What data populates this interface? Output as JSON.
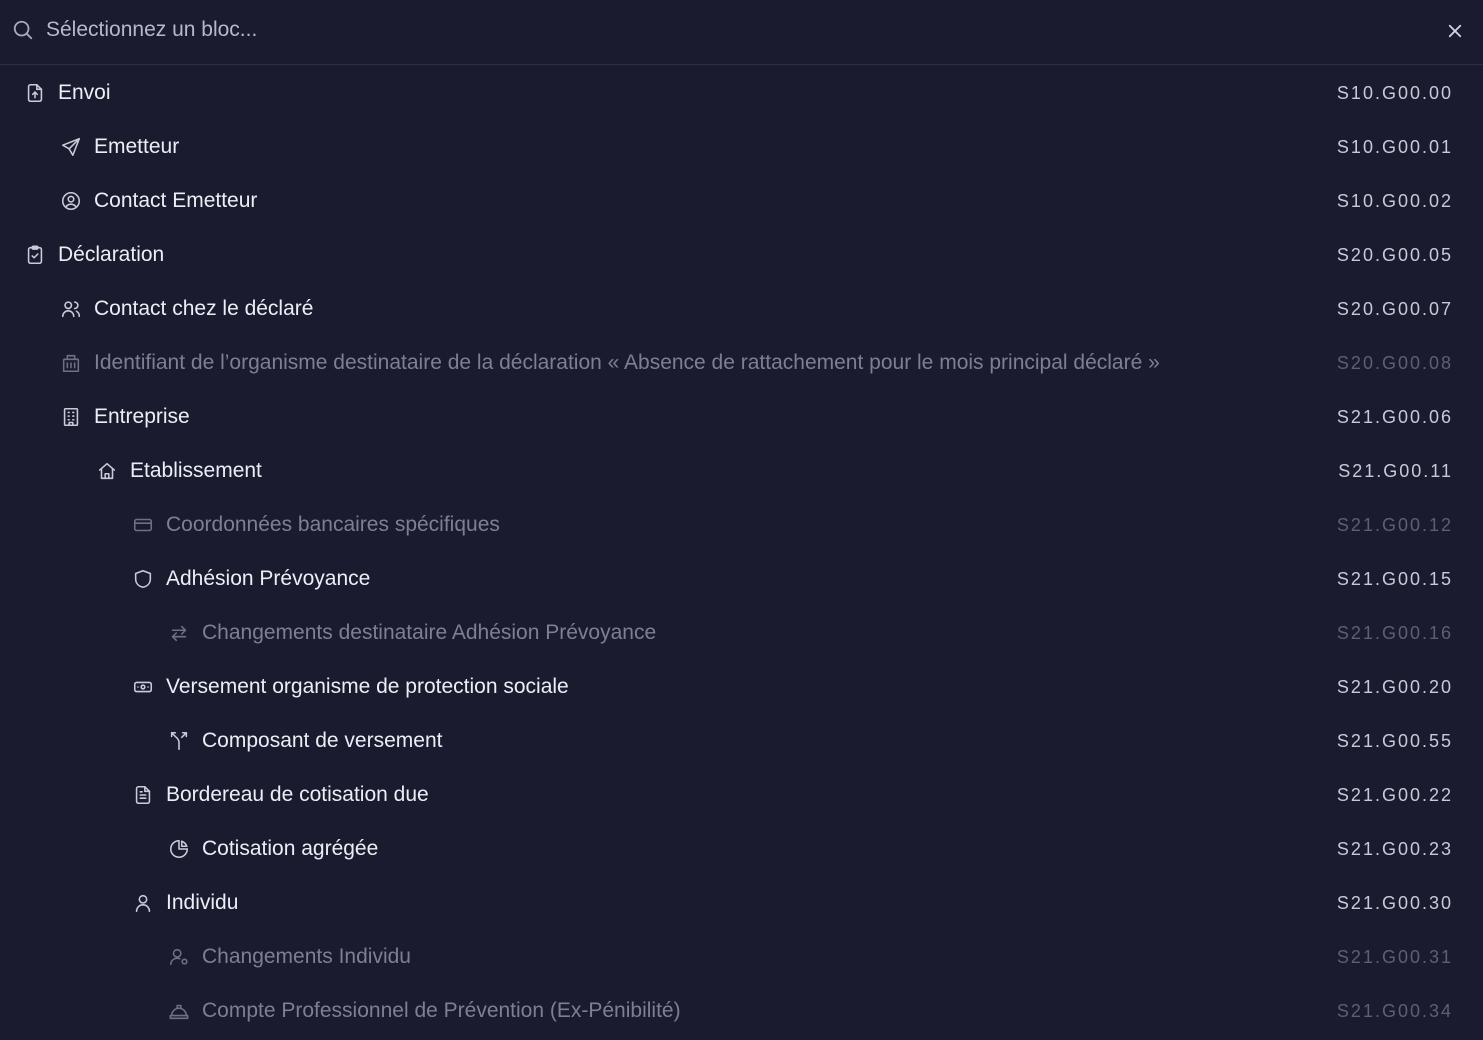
{
  "search": {
    "placeholder": "Sélectionnez un bloc..."
  },
  "colors": {
    "background": "#1b1b2f",
    "text": "#eceef6",
    "text_dim": "#7d7f92",
    "code": "#c8cad8",
    "code_dim": "#5d5f72"
  },
  "items": [
    {
      "label": "Envoi",
      "code": "S10.G00.00",
      "icon": "file-upload-icon",
      "level": 0,
      "dim": false
    },
    {
      "label": "Emetteur",
      "code": "S10.G00.01",
      "icon": "send-icon",
      "level": 1,
      "dim": false
    },
    {
      "label": "Contact Emetteur",
      "code": "S10.G00.02",
      "icon": "user-circle-icon",
      "level": 1,
      "dim": false
    },
    {
      "label": "Déclaration",
      "code": "S20.G00.05",
      "icon": "clipboard-check-icon",
      "level": 0,
      "dim": false
    },
    {
      "label": "Contact chez le déclaré",
      "code": "S20.G00.07",
      "icon": "users-icon",
      "level": 1,
      "dim": false
    },
    {
      "label": "Identifiant de l’organisme destinataire de la déclaration « Absence de rattachement pour le mois principal déclaré »",
      "code": "S20.G00.08",
      "icon": "building-bank-icon",
      "level": 1,
      "dim": true
    },
    {
      "label": "Entreprise",
      "code": "S21.G00.06",
      "icon": "building-icon",
      "level": 1,
      "dim": false
    },
    {
      "label": "Etablissement",
      "code": "S21.G00.11",
      "icon": "home-icon",
      "level": 2,
      "dim": false
    },
    {
      "label": "Coordonnées bancaires spécifiques",
      "code": "S21.G00.12",
      "icon": "credit-card-icon",
      "level": 3,
      "dim": true
    },
    {
      "label": "Adhésion Prévoyance",
      "code": "S21.G00.15",
      "icon": "shield-icon",
      "level": 3,
      "dim": false
    },
    {
      "label": "Changements destinataire Adhésion Prévoyance",
      "code": "S21.G00.16",
      "icon": "arrows-exchange-icon",
      "level": 4,
      "dim": true
    },
    {
      "label": "Versement organisme de protection sociale",
      "code": "S21.G00.20",
      "icon": "cash-icon",
      "level": 3,
      "dim": false
    },
    {
      "label": "Composant de versement",
      "code": "S21.G00.55",
      "icon": "split-icon",
      "level": 4,
      "dim": false
    },
    {
      "label": "Bordereau de cotisation due",
      "code": "S21.G00.22",
      "icon": "file-text-icon",
      "level": 3,
      "dim": false
    },
    {
      "label": "Cotisation agrégée",
      "code": "S21.G00.23",
      "icon": "pie-chart-icon",
      "level": 4,
      "dim": false
    },
    {
      "label": "Individu",
      "code": "S21.G00.30",
      "icon": "user-icon",
      "level": 3,
      "dim": false
    },
    {
      "label": "Changements Individu",
      "code": "S21.G00.31",
      "icon": "user-cog-icon",
      "level": 4,
      "dim": true
    },
    {
      "label": "Compte Professionnel de Prévention (Ex-Pénibilité)",
      "code": "S21.G00.34",
      "icon": "helmet-icon",
      "level": 4,
      "dim": true
    }
  ]
}
